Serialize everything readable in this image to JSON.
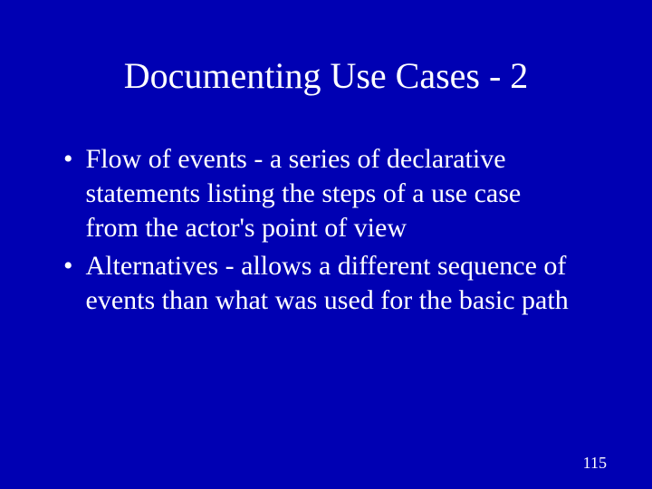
{
  "slide": {
    "title": "Documenting Use Cases - 2",
    "bullets": [
      "Flow of events - a series of declarative statements listing the steps of a use case from the actor's point of view",
      "Alternatives - allows a different sequence of events than what was used for the basic path"
    ],
    "page_number": "115"
  }
}
